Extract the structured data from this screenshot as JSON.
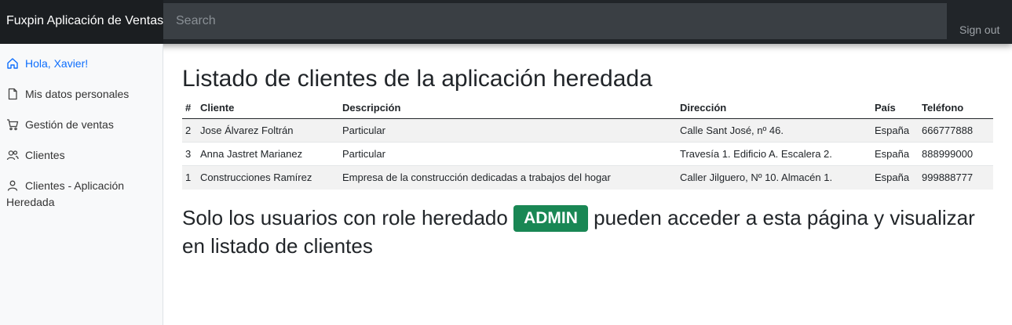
{
  "header": {
    "brand": "Fuxpin Aplicación de Ventas",
    "search_placeholder": "Search",
    "signout": "Sign out"
  },
  "sidebar": {
    "items": [
      {
        "label": "Hola, Xavier!",
        "icon": "home-icon",
        "active": true
      },
      {
        "label": "Mis datos personales",
        "icon": "file-icon"
      },
      {
        "label": "Gestión de ventas",
        "icon": "cart-icon"
      },
      {
        "label": "Clientes",
        "icon": "users-icon"
      },
      {
        "label": "Clientes - Aplicación Heredada",
        "icon": "user-icon"
      }
    ]
  },
  "main": {
    "title": "Listado de clientes de la aplicación heredada",
    "table": {
      "headers": [
        "#",
        "Cliente",
        "Descripción",
        "Dirección",
        "País",
        "Teléfono"
      ],
      "rows": [
        [
          "2",
          "Jose Álvarez Foltrán",
          "Particular",
          "Calle Sant José, nº 46.",
          "España",
          "666777888"
        ],
        [
          "3",
          "Anna Jastret Marianez",
          "Particular",
          "Travesía 1. Edificio A. Escalera 2.",
          "España",
          "888999000"
        ],
        [
          "1",
          "Construcciones Ramírez",
          "Empresa de la construcción dedicadas a trabajos del hogar",
          "Caller Jilguero, Nº 10. Almacén 1.",
          "España",
          "999888777"
        ]
      ]
    },
    "notice": {
      "before": "Solo los usuarios con role heredado",
      "badge": "ADMIN",
      "after": "pueden acceder a esta página y visualizar en listado de clientes"
    }
  },
  "colors": {
    "topbar": "#212529",
    "active_link": "#0d6efd",
    "badge": "#198754"
  }
}
